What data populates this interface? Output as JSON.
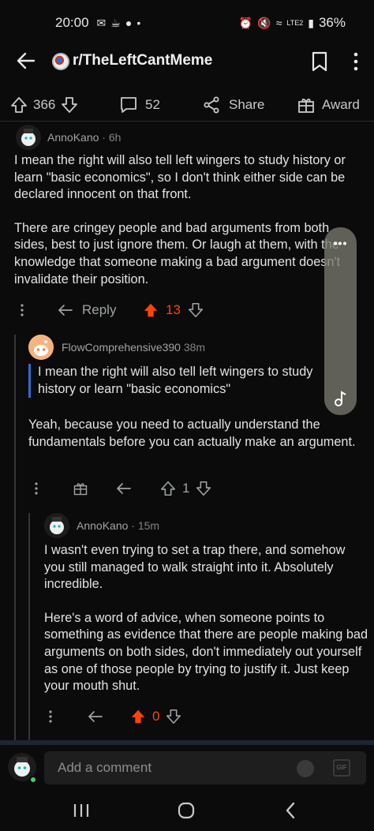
{
  "status": {
    "time": "20:00",
    "notif_icons": [
      "M",
      "☕",
      "●",
      "•"
    ],
    "network": "LTE2",
    "battery": "36%"
  },
  "appbar": {
    "subreddit": "r/TheLeftCantMeme"
  },
  "post": {
    "upvotes": "366",
    "comments": "52",
    "share_label": "Share",
    "award_label": "Award"
  },
  "comments": [
    {
      "user": "AnnoKano",
      "age": "6h",
      "body": [
        "I mean the right will also tell left wingers to study history or learn \"basic economics\", so I don't think either side can be declared innocent on that front.",
        "There are cringey people and bad arguments from both sides, best to just ignore them. Or laugh at them, with the knowledge that someone making a bad argument doesn't invalidate their position."
      ],
      "reply_label": "Reply",
      "score": "13",
      "score_color": "#ff4500"
    },
    {
      "user": "FlowComprehensive390",
      "age": "38m",
      "quote": "I mean the right will also tell left wingers to study history or learn \"basic economics\"",
      "body": [
        "Yeah, because you need to actually understand the fundamentals before you can actually make an argument."
      ],
      "score": "1"
    },
    {
      "user": "AnnoKano",
      "age": "15m",
      "body": [
        "I wasn't even trying to set a trap there, and somehow you still managed to walk straight into it. Absolutely incredible.",
        "Here's a word of advice, when someone points to something as evidence that there are people making bad arguments on both sides, don't immediately out yourself as one of those people by trying to justify it. Just keep your mouth shut."
      ],
      "score": "0",
      "score_color": "#ff4500"
    }
  ],
  "comment_bar": {
    "placeholder": "Add a comment",
    "gif_label": "GIF"
  }
}
